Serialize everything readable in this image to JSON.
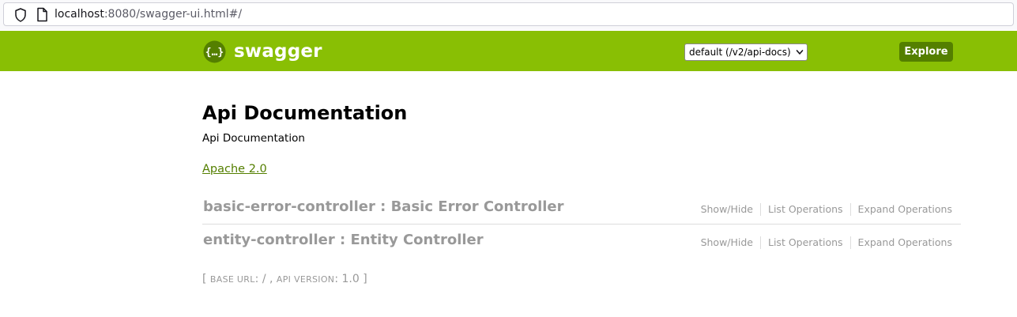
{
  "browser": {
    "url_host": "localhost",
    "url_rest": ":8080/swagger-ui.html#/"
  },
  "header": {
    "brand": "swagger",
    "spec_select_value": "default (/v2/api-docs)",
    "explore_label": "Explore",
    "header_color": "#89bf04",
    "explore_color": "#547f00"
  },
  "info": {
    "title": "Api Documentation",
    "description": "Api Documentation",
    "license": "Apache 2.0"
  },
  "resources": [
    {
      "name": "basic-error-controller : Basic Error Controller",
      "show_hide": "Show/Hide",
      "list_operations": "List Operations",
      "expand_operations": "Expand Operations"
    },
    {
      "name": "entity-controller : Entity Controller",
      "show_hide": "Show/Hide",
      "list_operations": "List Operations",
      "expand_operations": "Expand Operations"
    }
  ],
  "footer": {
    "open_bracket": "[ ",
    "base_url_label": "BASE URL",
    "base_url_value": ": / , ",
    "api_version_label": "API VERSION",
    "api_version_value": ": 1.0 ]"
  },
  "icons": [
    "shield-icon",
    "page-icon",
    "swagger-logo-icon",
    "chevron-down-icon"
  ]
}
